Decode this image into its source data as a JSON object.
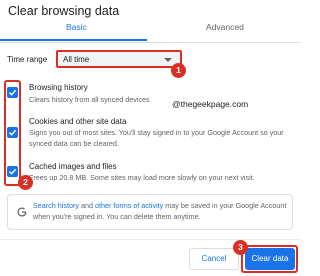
{
  "dialog": {
    "title": "Clear browsing data"
  },
  "tabs": [
    {
      "label": "Basic"
    },
    {
      "label": "Advanced"
    }
  ],
  "time_range": {
    "label": "Time range",
    "value": "All time"
  },
  "items": [
    {
      "title": "Browsing history",
      "desc": "Clears history from all synced devices",
      "checked": true
    },
    {
      "title": "Cookies and other site data",
      "desc": "Signs you out of most sites. You'll stay signed in to your Google Account so your synced data can be cleared.",
      "checked": true
    },
    {
      "title": "Cached images and files",
      "desc": "Frees up 20.8 MB. Some sites may load more slowly on your next visit.",
      "checked": true
    }
  ],
  "watermark": "@thegeekpage.com",
  "info": {
    "link1": "Search history",
    "mid": " and ",
    "link2": "other forms of activity",
    "rest": " may be saved in your Google Account when you're signed in. You can delete them anytime."
  },
  "buttons": {
    "cancel": "Cancel",
    "clear": "Clear data"
  },
  "badges": [
    "1",
    "2",
    "3"
  ],
  "colors": {
    "accent": "#1a73e8",
    "annotation": "#d93025"
  }
}
